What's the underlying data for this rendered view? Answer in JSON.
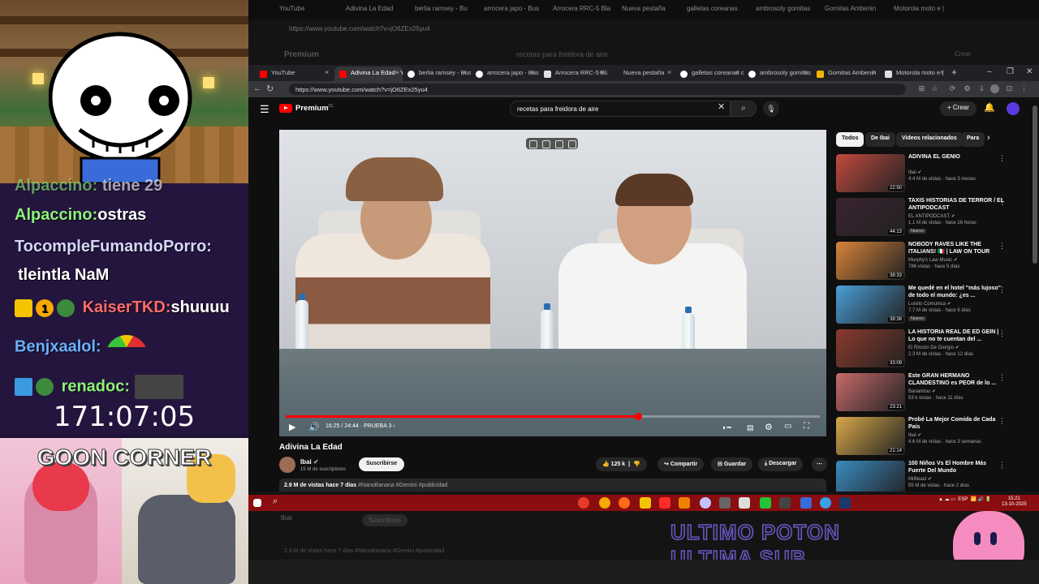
{
  "overlay": {
    "chat": [
      {
        "user": "Alpaccino:",
        "msg": "tiene 29",
        "cut": true
      },
      {
        "user": "Alpaccino:",
        "msg": "ostras"
      },
      {
        "user": "TocompleFumandoPorro:",
        "msg": "tleintla NaM"
      },
      {
        "user": "KaiserTKD:",
        "msg": "shuuuu",
        "badge": "1"
      },
      {
        "user": "Benjxaalol:",
        "msg": ""
      },
      {
        "user": "renadoc:",
        "msg": ""
      }
    ],
    "timer": "171:07:05",
    "corner_title": "GOON CORNER"
  },
  "ghost": {
    "tabs": [
      "YouTube",
      "Adivina La Edad",
      "berlia ramsey - Bu",
      "arrocera japo - Bus",
      "Arrocera RRC-5 Bla",
      "Nueva pestaña",
      "galletas coreanas",
      "ambrosoly gomitas",
      "Gomitas Ambenin",
      "Motorola moto e |"
    ],
    "url": "https://www.youtube.com/watch?v=jO6ZEx25yu4",
    "search": "recetas para freidora de aire",
    "premium": "Premium",
    "create": "Crear",
    "subscribe": "Suscribirse",
    "channel": "Ibai",
    "desc": "2.9 M de vistas  hace 7 días  #NanoBanana #Gemini #publicidad",
    "watermark_1": "ULTIMO POTON",
    "watermark_2": "ULTIMA SUB"
  },
  "browser": {
    "tabs": [
      {
        "label": "YouTube",
        "color": "#ff0000"
      },
      {
        "label": "Adivina La Edad - Y",
        "color": "#ff0000",
        "active": true
      },
      {
        "label": "berlia ramsey - Bus",
        "color": "#ffffff"
      },
      {
        "label": "arrocera japo - Bus",
        "color": "#ffffff"
      },
      {
        "label": "Arrocera RRC-5 Bla",
        "color": "#e0e0e0"
      },
      {
        "label": "Nueva pestaña",
        "color": "#888888"
      },
      {
        "label": "galletas coreanas d",
        "color": "#ffffff"
      },
      {
        "label": "ambrosoly gomitas",
        "color": "#ffffff"
      },
      {
        "label": "Gomitas Ambenin",
        "color": "#f5b400"
      },
      {
        "label": "Motorola moto e |",
        "color": "#e0e0e0"
      }
    ],
    "url": "https://www.youtube.com/watch?v=jO6ZEx25yu4"
  },
  "youtube": {
    "brand": "Premium",
    "brand_region": "CL",
    "search_value": "recetas para freidora de aire",
    "create_label": "Crear",
    "player": {
      "timecode": "16:25 / 24:44",
      "chapter": "PRUEBA 3",
      "progress": 0.66
    },
    "video_title": "Adivina La Edad",
    "channel_name": "Ibai",
    "channel_subs": "15 M de suscriptores",
    "subscribe_label": "Suscribirse",
    "likes": "125 k",
    "share_label": "Compartir",
    "save_label": "Guardar",
    "download_label": "Descargar",
    "desc_stats": "2.9 M de vistas  hace 7 días",
    "desc_tags": "#NanoBanana #Gemini #publicidad",
    "chips": [
      "Todos",
      "De Ibai",
      "Videos relacionados",
      "Para"
    ],
    "recs": [
      {
        "title": "ADIVINA EL GENIO",
        "channel": "Ibai",
        "meta": "4.4 M de vistas · hace 3 meses",
        "duration": "22:50",
        "thumb": "#c14a3e"
      },
      {
        "title": "TAXIS HISTORIAS DE TERROR / EL ANTIPODCAST",
        "channel": "EL ANTIPODCAST",
        "meta": "1.1 M de vistas · hace 16 horas",
        "duration": "44:13",
        "thumb": "#3a2330",
        "new": "Nuevo"
      },
      {
        "title": "NOBODY RAVES LIKE THE ITALIANS! 🇮🇹 | LAW ON TOUR",
        "channel": "Murphy's Law Music",
        "meta": "786 vistas · hace 5 días",
        "duration": "38:33",
        "thumb": "#d8843a"
      },
      {
        "title": "Me quedé en el hotel \"más lujoso\" de todo el mundo: ¿es ...",
        "channel": "Luisito Comunica",
        "meta": "7.7 M de vistas · hace 6 días",
        "duration": "38:38",
        "thumb": "#4ba0d8",
        "new": "Nuevo"
      },
      {
        "title": "LA HISTORIA REAL DE ED GEIN | Lo que no te cuentan del ...",
        "channel": "El Rincón De Giorgio",
        "meta": "2.3 M de vistas · hace 12 días",
        "duration": "33:09",
        "thumb": "#8b3a2c"
      },
      {
        "title": "Este GRAN HERMANO CLANDESTINO es PEOR de lo ...",
        "channel": "Bananirou",
        "meta": "53 k vistas · hace 11 días",
        "duration": "23:21",
        "thumb": "#c76a6a"
      },
      {
        "title": "Probé La Mejor Comida de Cada País",
        "channel": "Ibai",
        "meta": "4.6 M de vistas · hace 3 semanas",
        "duration": "21:14",
        "thumb": "#d8a84a"
      },
      {
        "title": "100 Niños Vs El Hombre Más Fuerte Del Mundo",
        "channel": "MrBeast",
        "meta": "55 M de vistas · hace 2 días",
        "duration": "27:21",
        "thumb": "#3a8ac0"
      }
    ]
  },
  "taskbar": {
    "tray_lang": "ESP",
    "time": "15:21",
    "date": "13-10-2025"
  }
}
